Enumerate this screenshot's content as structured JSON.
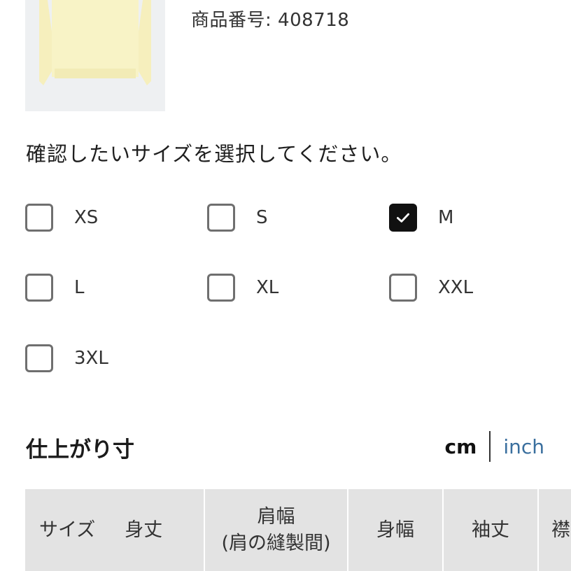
{
  "product": {
    "number_label": "商品番号: 408718"
  },
  "instruction": "確認したいサイズを選択してください。",
  "sizes": [
    {
      "label": "XS",
      "checked": false
    },
    {
      "label": "S",
      "checked": false
    },
    {
      "label": "M",
      "checked": true
    },
    {
      "label": "L",
      "checked": false
    },
    {
      "label": "XL",
      "checked": false
    },
    {
      "label": "XXL",
      "checked": false
    },
    {
      "label": "3XL",
      "checked": false
    }
  ],
  "measurements": {
    "title": "仕上がり寸",
    "unit_cm": "cm",
    "unit_inch": "inch"
  },
  "table": {
    "headers": {
      "size": "サイズ",
      "length": "身丈",
      "shoulder": "肩幅",
      "shoulder_note": "(肩の縫製間)",
      "body_width": "身幅",
      "sleeve": "袖丈",
      "partial": "襟"
    }
  },
  "colors": {
    "link": "#3a6f9e",
    "table_header_bg": "#e3e3e3",
    "sweater": "#f7f2c4"
  }
}
